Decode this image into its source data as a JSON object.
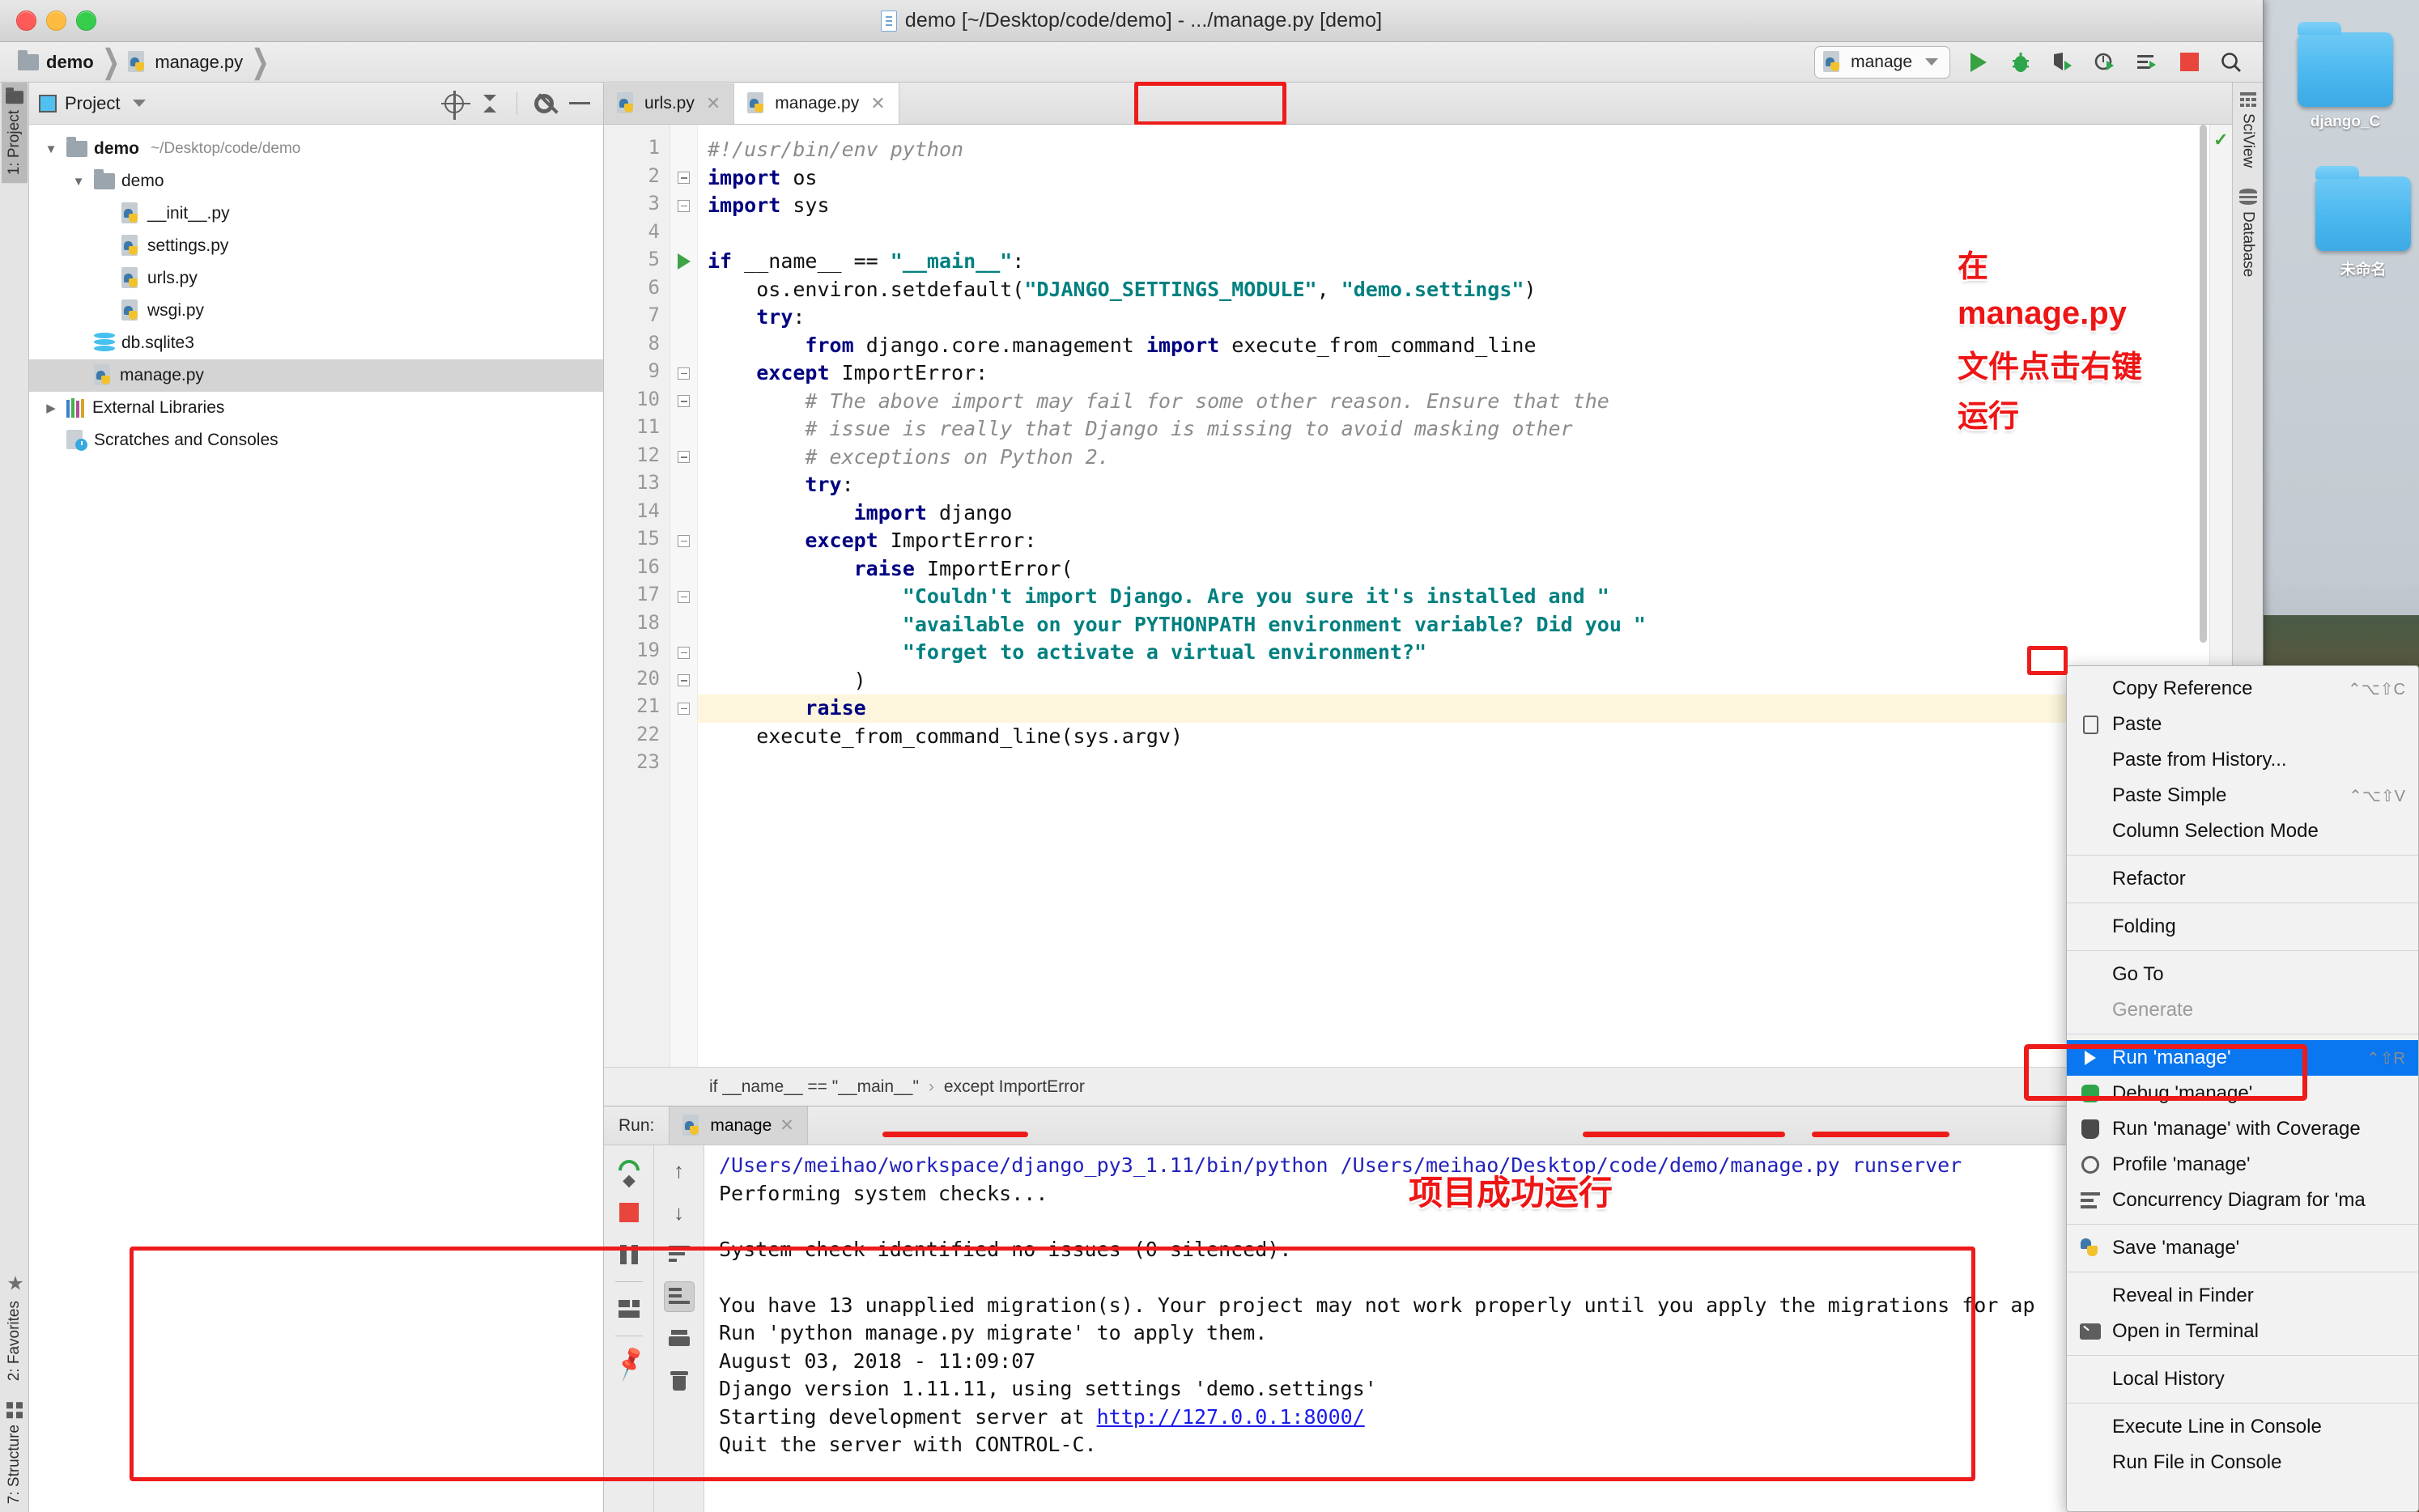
{
  "window": {
    "title": "demo [~/Desktop/code/demo] - .../manage.py [demo]",
    "traffic": {
      "close": "close-button",
      "minimize": "minimize-button",
      "zoom": "zoom-button"
    }
  },
  "navbar": {
    "crumbs": [
      "demo",
      "manage.py"
    ],
    "run_config": "manage",
    "buttons": [
      "run",
      "debug",
      "run-with-coverage",
      "profile",
      "concurrency-diagram",
      "stop",
      "search"
    ]
  },
  "project_panel": {
    "title": "Project",
    "tree": [
      {
        "indent": 0,
        "arrow": "▼",
        "icon": "folder",
        "label": "demo",
        "bold": true,
        "path": "~/Desktop/code/demo",
        "selected": false
      },
      {
        "indent": 1,
        "arrow": "▼",
        "icon": "folder",
        "label": "demo",
        "bold": false,
        "path": "",
        "selected": false
      },
      {
        "indent": 2,
        "arrow": "",
        "icon": "python",
        "label": "__init__.py",
        "bold": false,
        "path": "",
        "selected": false
      },
      {
        "indent": 2,
        "arrow": "",
        "icon": "python",
        "label": "settings.py",
        "bold": false,
        "path": "",
        "selected": false
      },
      {
        "indent": 2,
        "arrow": "",
        "icon": "python",
        "label": "urls.py",
        "bold": false,
        "path": "",
        "selected": false
      },
      {
        "indent": 2,
        "arrow": "",
        "icon": "python",
        "label": "wsgi.py",
        "bold": false,
        "path": "",
        "selected": false
      },
      {
        "indent": 1,
        "arrow": "",
        "icon": "db",
        "label": "db.sqlite3",
        "bold": false,
        "path": "",
        "selected": false
      },
      {
        "indent": 1,
        "arrow": "",
        "icon": "python",
        "label": "manage.py",
        "bold": false,
        "path": "",
        "selected": true
      },
      {
        "indent": 0,
        "arrow": "▶",
        "icon": "libs",
        "label": "External Libraries",
        "bold": false,
        "path": "",
        "selected": false
      },
      {
        "indent": 0,
        "arrow": "",
        "icon": "scratches",
        "label": "Scratches and Consoles",
        "bold": false,
        "path": "",
        "selected": false
      }
    ]
  },
  "left_rail": {
    "top": "1: Project",
    "bottom": [
      "2: Favorites",
      "7: Structure"
    ]
  },
  "right_rail": {
    "items": [
      "SciView",
      "Database"
    ]
  },
  "editor": {
    "tabs": [
      {
        "label": "urls.py",
        "active": false
      },
      {
        "label": "manage.py",
        "active": true
      }
    ],
    "breadcrumb": [
      "if __name__ == \"__main__\"",
      "except ImportError"
    ],
    "line_count": 23,
    "lines": [
      {
        "n": 1,
        "fold": "",
        "marker": "",
        "code": "#!/usr/bin/env python"
      },
      {
        "n": 2,
        "fold": "minus",
        "marker": "",
        "code": "import os"
      },
      {
        "n": 3,
        "fold": "minus",
        "marker": "",
        "code": "import sys"
      },
      {
        "n": 4,
        "fold": "",
        "marker": "",
        "code": ""
      },
      {
        "n": 5,
        "fold": "minus",
        "marker": "run",
        "code": "if __name__ == \"__main__\":"
      },
      {
        "n": 6,
        "fold": "",
        "marker": "",
        "code": "    os.environ.setdefault(\"DJANGO_SETTINGS_MODULE\", \"demo.settings\")"
      },
      {
        "n": 7,
        "fold": "",
        "marker": "",
        "code": "    try:"
      },
      {
        "n": 8,
        "fold": "",
        "marker": "",
        "code": "        from django.core.management import execute_from_command_line"
      },
      {
        "n": 9,
        "fold": "minus",
        "marker": "",
        "code": "    except ImportError:"
      },
      {
        "n": 10,
        "fold": "minus",
        "marker": "",
        "code": "        # The above import may fail for some other reason. Ensure that the"
      },
      {
        "n": 11,
        "fold": "",
        "marker": "",
        "code": "        # issue is really that Django is missing to avoid masking other"
      },
      {
        "n": 12,
        "fold": "minus",
        "marker": "",
        "code": "        # exceptions on Python 2."
      },
      {
        "n": 13,
        "fold": "",
        "marker": "",
        "code": "        try:"
      },
      {
        "n": 14,
        "fold": "",
        "marker": "",
        "code": "            import django"
      },
      {
        "n": 15,
        "fold": "minus",
        "marker": "",
        "code": "        except ImportError:"
      },
      {
        "n": 16,
        "fold": "",
        "marker": "",
        "code": "            raise ImportError("
      },
      {
        "n": 17,
        "fold": "minus",
        "marker": "",
        "code": "                \"Couldn't import Django. Are you sure it's installed and \""
      },
      {
        "n": 18,
        "fold": "",
        "marker": "",
        "code": "                \"available on your PYTHONPATH environment variable? Did you \""
      },
      {
        "n": 19,
        "fold": "minus",
        "marker": "",
        "code": "                \"forget to activate a virtual environment?\""
      },
      {
        "n": 20,
        "fold": "minus",
        "marker": "",
        "code": "            )"
      },
      {
        "n": 21,
        "fold": "minus",
        "marker": "",
        "code": "        raise"
      },
      {
        "n": 22,
        "fold": "",
        "marker": "",
        "code": "    execute_from_command_line(sys.argv)"
      },
      {
        "n": 23,
        "fold": "",
        "marker": "",
        "code": ""
      }
    ]
  },
  "run_panel": {
    "label": "Run:",
    "tab": "manage",
    "console_lines": [
      "/Users/meihao/workspace/django_py3_1.11/bin/python /Users/meihao/Desktop/code/demo/manage.py runserver",
      "Performing system checks...",
      "",
      "System check identified no issues (0 silenced).",
      "",
      "You have 13 unapplied migration(s). Your project may not work properly until you apply the migrations for ap",
      "Run 'python manage.py migrate' to apply them.",
      "August 03, 2018 - 11:09:07",
      "Django version 1.11.11, using settings 'demo.settings'",
      "Starting development server at http://127.0.0.1:8000/",
      "Quit the server with CONTROL-C."
    ],
    "server_url": "http://127.0.0.1:8000/",
    "tool_buttons": [
      "rerun",
      "stop",
      "pause",
      "layout",
      "pin",
      "scroll-up",
      "scroll-down",
      "soft-wrap",
      "scroll-to-end",
      "print",
      "clear-all"
    ]
  },
  "context_menu": {
    "items": [
      {
        "label": "Copy Reference",
        "icon": "",
        "sub": "⌃⌥⇧C",
        "selected": false,
        "disabled": false
      },
      {
        "label": "Paste",
        "icon": "clipboard",
        "sub": "",
        "selected": false,
        "disabled": false
      },
      {
        "label": "Paste from History...",
        "icon": "",
        "sub": "",
        "selected": false,
        "disabled": false
      },
      {
        "label": "Paste Simple",
        "icon": "",
        "sub": "⌃⌥⇧V",
        "selected": false,
        "disabled": false
      },
      {
        "label": "Column Selection Mode",
        "icon": "",
        "sub": "",
        "selected": false,
        "disabled": false
      },
      {
        "label": "__SEP__"
      },
      {
        "label": "Refactor",
        "icon": "",
        "sub": "",
        "selected": false,
        "disabled": false
      },
      {
        "label": "__SEP__"
      },
      {
        "label": "Folding",
        "icon": "",
        "sub": "",
        "selected": false,
        "disabled": false
      },
      {
        "label": "__SEP__"
      },
      {
        "label": "Go To",
        "icon": "",
        "sub": "",
        "selected": false,
        "disabled": false
      },
      {
        "label": "Generate",
        "icon": "",
        "sub": "",
        "selected": false,
        "disabled": true
      },
      {
        "label": "__SEP__"
      },
      {
        "label": "Run 'manage'",
        "icon": "run-triangle",
        "sub": "⌃⇧R",
        "selected": true,
        "disabled": false
      },
      {
        "label": "Debug 'manage'",
        "icon": "bug",
        "sub": "",
        "selected": false,
        "disabled": false
      },
      {
        "label": "Run 'manage' with Coverage",
        "icon": "shield",
        "sub": "",
        "selected": false,
        "disabled": false
      },
      {
        "label": "Profile 'manage'",
        "icon": "clock",
        "sub": "",
        "selected": false,
        "disabled": false
      },
      {
        "label": "Concurrency Diagram for 'ma",
        "icon": "concurrency",
        "sub": "",
        "selected": false,
        "disabled": false
      },
      {
        "label": "__SEP__"
      },
      {
        "label": "Save 'manage'",
        "icon": "python",
        "sub": "",
        "selected": false,
        "disabled": false
      },
      {
        "label": "__SEP__"
      },
      {
        "label": "Reveal in Finder",
        "icon": "",
        "sub": "",
        "selected": false,
        "disabled": false
      },
      {
        "label": "Open in Terminal",
        "icon": "terminal",
        "sub": "",
        "selected": false,
        "disabled": false
      },
      {
        "label": "__SEP__"
      },
      {
        "label": "Local History",
        "icon": "",
        "sub": "",
        "selected": false,
        "disabled": false
      },
      {
        "label": "__SEP__"
      },
      {
        "label": "Execute Line in Console",
        "icon": "",
        "sub": "",
        "selected": false,
        "disabled": false
      },
      {
        "label": "Run File in Console",
        "icon": "",
        "sub": "",
        "selected": false,
        "disabled": false
      }
    ]
  },
  "annotations": {
    "top_right": [
      "在",
      "manage.py",
      "文件点击右键",
      "运行"
    ],
    "console": "项目成功运行"
  },
  "desktop": {
    "folders": [
      {
        "label": "django_C"
      },
      {
        "label": "未命名"
      }
    ]
  },
  "colors": {
    "accent_red": "#ee1b1b",
    "menu_select_blue": "#0a76ef",
    "string_teal": "#008080",
    "keyword_navy": "#000080",
    "comment_gray": "#8c8c8c",
    "run_green": "#37a03f"
  }
}
